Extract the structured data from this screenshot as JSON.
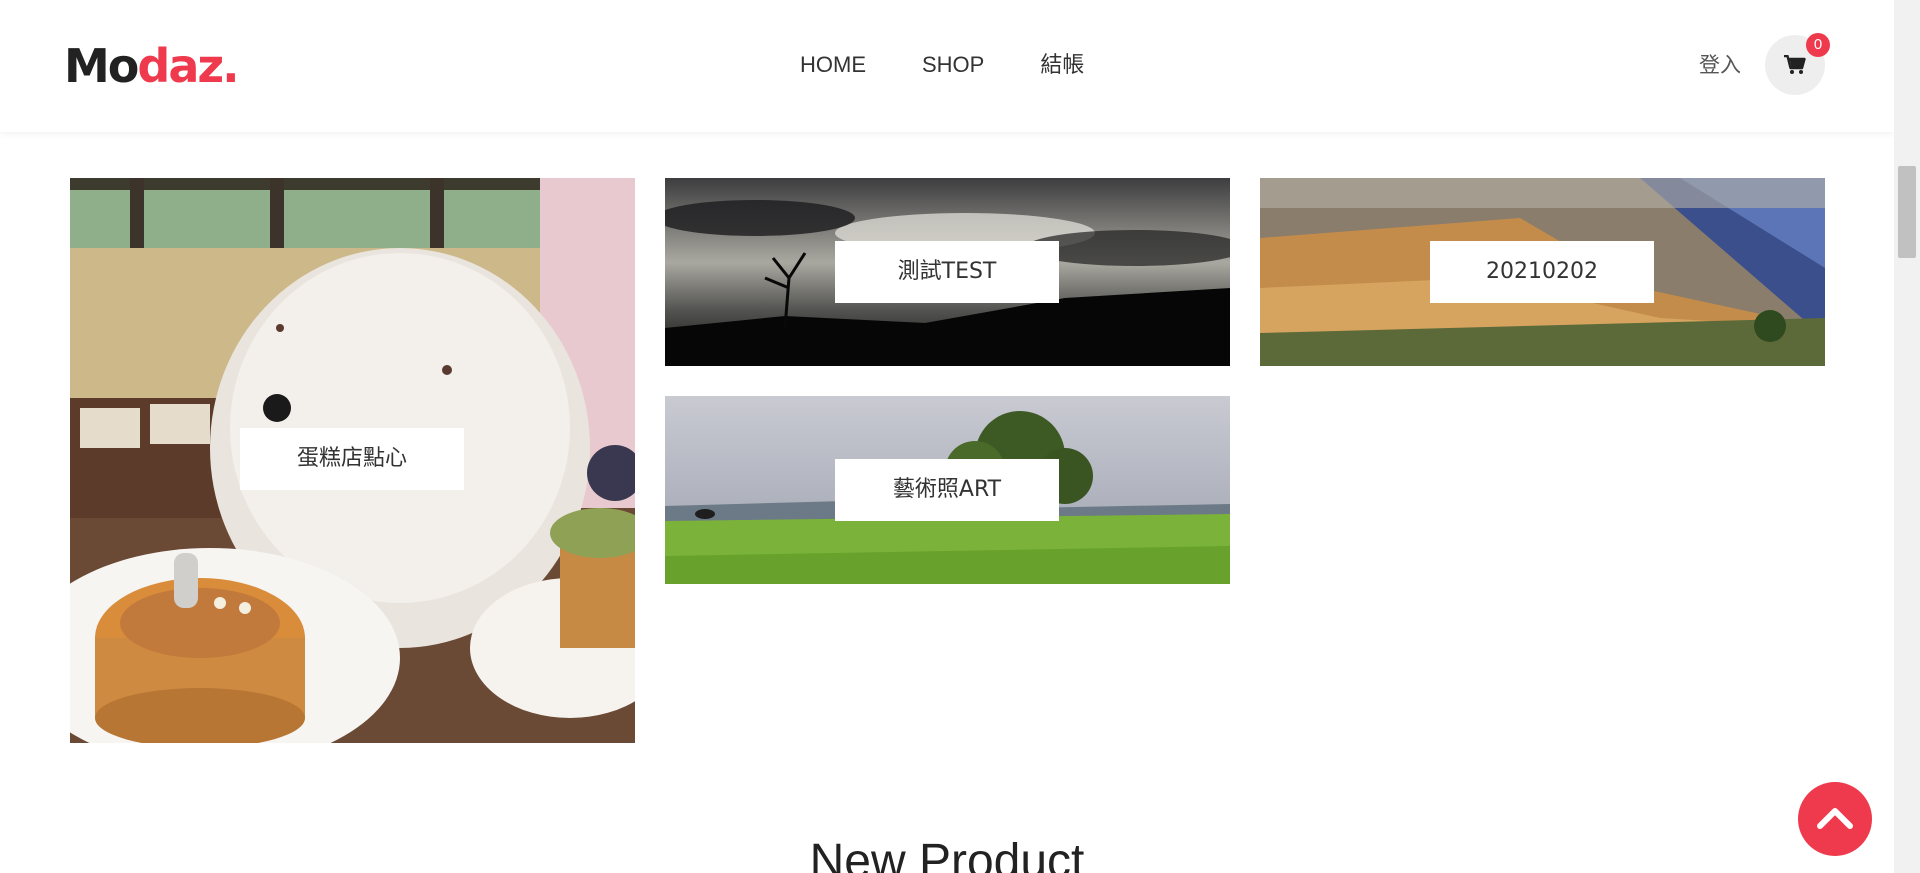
{
  "header": {
    "logo_main": "Mo",
    "logo_accent": "daz.",
    "nav": [
      {
        "label": "HOME"
      },
      {
        "label": "SHOP"
      },
      {
        "label": "結帳"
      }
    ],
    "login_label": "登入",
    "cart_count": "0",
    "cart_icon": "cart-icon"
  },
  "categories": [
    {
      "label": "蛋糕店點心"
    },
    {
      "label": "測試TEST"
    },
    {
      "label": "20210202"
    },
    {
      "label": "藝術照ART"
    }
  ],
  "section": {
    "title": "New Product"
  },
  "colors": {
    "accent": "#ee3a4c",
    "text": "#333333"
  },
  "icons": {
    "back_to_top": "chevron-up-icon"
  }
}
